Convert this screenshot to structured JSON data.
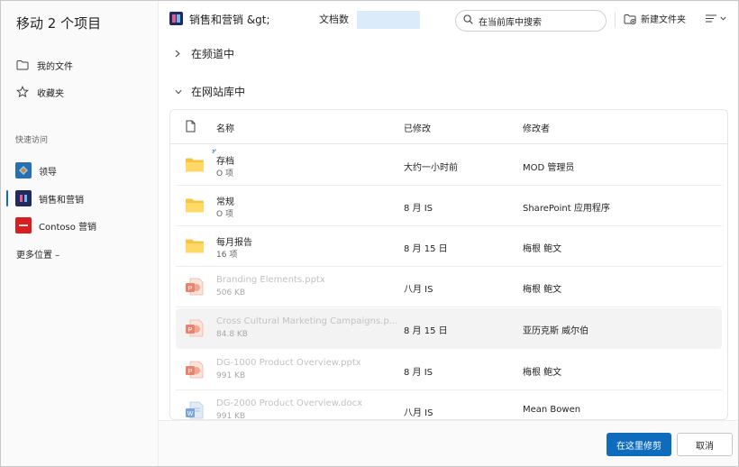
{
  "dialog": {
    "title": "移动 2 个项目"
  },
  "left_nav": {
    "items": [
      {
        "label": "我的文件",
        "icon": "folder-icon"
      },
      {
        "label": "收藏夹",
        "icon": "star-icon"
      }
    ],
    "quick_access_label": "快速访问",
    "sites": [
      {
        "label": "领导",
        "icon": "site-leadership-icon",
        "color": "#2a6fb0"
      },
      {
        "label": "销售和营销",
        "icon": "site-sales-marketing-icon",
        "color": "#1f2b5e"
      },
      {
        "label": "Contoso 营销",
        "icon": "site-contoso-icon",
        "color": "#d81e1e"
      }
    ],
    "more_places": "更多位置 –"
  },
  "header": {
    "breadcrumb": "销售和营销 &gt;",
    "breadcrumb_tail": "文档数",
    "search_placeholder": "在当前库中搜索",
    "new_folder": "新建文件夹"
  },
  "groups": {
    "in_channel": "在频道中",
    "in_library": "在网站库中"
  },
  "table": {
    "headers": {
      "name": "名称",
      "modified": "已修改",
      "modified_by": "修改者"
    },
    "rows": [
      {
        "name": "存档",
        "sub": "O 项",
        "modified": "大约一小时前",
        "modified_by": "MOD 管理员",
        "type": "folder"
      },
      {
        "name": "常规",
        "sub": "O 项",
        "modified": "8 月 IS",
        "modified_by": "SharePoint 应用程序",
        "type": "folder"
      },
      {
        "name": "每月报告",
        "sub": "16 项",
        "modified": "8 月 15 日",
        "modified_by": "梅根 鲍文",
        "type": "folder"
      },
      {
        "name": "Branding Elements.pptx",
        "sub": "506 KB",
        "modified": "八月    IS",
        "modified_by": "梅根 鲍文",
        "type": "pptx"
      },
      {
        "name": "Cross Cultural Marketing Campaigns.p...",
        "sub": "84.8 KB",
        "modified": "8 月 15 日",
        "modified_by": "亚历克斯 威尔伯",
        "type": "pptx"
      },
      {
        "name": "DG-1000 Product Overview.pptx",
        "sub": "991 KB",
        "modified": "8 月 IS",
        "modified_by": "梅根 鲍文",
        "type": "pptx"
      },
      {
        "name": "DG-2000 Product Overview.docx",
        "sub": "991 KB",
        "modified": "八月    IS",
        "modified_by": "Mean Bowen",
        "type": "docx"
      }
    ]
  },
  "footer": {
    "primary": "在这里修剪",
    "cancel": "取消"
  },
  "colors": {
    "accent": "#0f6cbd",
    "folder": "#f5c542",
    "pptx": "#e8846e",
    "selected_row": "#f3f3f3"
  }
}
